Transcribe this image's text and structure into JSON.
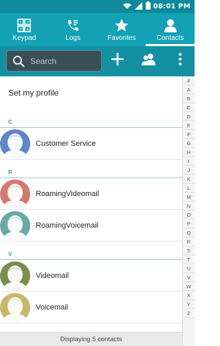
{
  "status_bar": {
    "time": "08:01 PM",
    "icons": [
      "wifi-icon",
      "signal-icon",
      "battery-icon"
    ]
  },
  "tabs": [
    {
      "label": "Keypad",
      "icon": "keypad-icon",
      "active": false
    },
    {
      "label": "Logs",
      "icon": "phone-log-icon",
      "active": false
    },
    {
      "label": "Favorites",
      "icon": "star-icon",
      "active": false
    },
    {
      "label": "Contacts",
      "icon": "person-icon",
      "active": true
    }
  ],
  "toolbar": {
    "search_placeholder": "Search",
    "add_icon": "plus-icon",
    "groups_icon": "groups-icon",
    "more_icon": "more-vert-icon"
  },
  "profile": {
    "label": "Set my profile"
  },
  "sections": [
    {
      "letter": "C",
      "contacts": [
        {
          "name": "Customer Service",
          "avatar_color": "#5f86c5"
        }
      ]
    },
    {
      "letter": "R",
      "contacts": [
        {
          "name": "RoamingVideomail",
          "avatar_color": "#d27a6e"
        },
        {
          "name": "RoamingVoicemail",
          "avatar_color": "#6aa9a6"
        }
      ]
    },
    {
      "letter": "V",
      "contacts": [
        {
          "name": "Videomail",
          "avatar_color": "#7a8f4e"
        },
        {
          "name": "Voicemail",
          "avatar_color": "#c8b86a"
        }
      ]
    }
  ],
  "index_letters": [
    "#",
    "A",
    "B",
    "C",
    "D",
    "E",
    "F",
    "G",
    "H",
    "I",
    "J",
    "K",
    "L",
    "M",
    "N",
    "O",
    "P",
    "Q",
    "R",
    "S",
    "T",
    "U",
    "V",
    "W",
    "X",
    "Y",
    "Z"
  ],
  "footer": {
    "text": "Displaying 5 contacts"
  },
  "colors": {
    "status_bar": "#0f8a9c",
    "tab_bar": "#13a1b5",
    "toolbar": "#1391a3",
    "section_letter": "#16a0b4"
  }
}
